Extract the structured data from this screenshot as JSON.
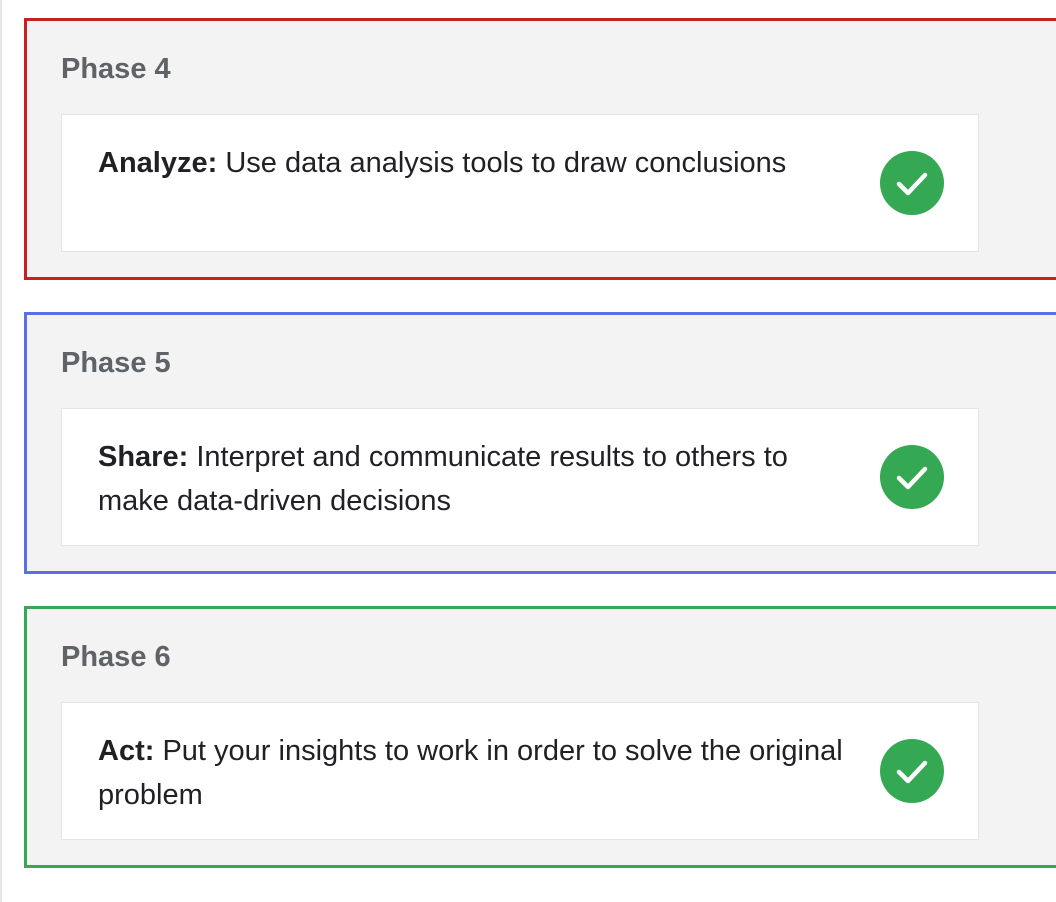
{
  "colors": {
    "phase4_border": "#c5221f",
    "phase5_border": "#5b6fe6",
    "phase6_border": "#34a853",
    "panel_bg": "#f3f3f3",
    "check_green": "#34a853"
  },
  "phases": [
    {
      "title": "Phase 4",
      "term": "Analyze:",
      "description": " Use data analysis tools to draw conclusions",
      "status_icon": "checkmark-circle-icon"
    },
    {
      "title": "Phase 5",
      "term": "Share:",
      "description": " Interpret and communicate results to others to make data-driven decisions",
      "status_icon": "checkmark-circle-icon"
    },
    {
      "title": "Phase 6",
      "term": "Act:",
      "description": " Put your insights to work in order to solve the original problem",
      "status_icon": "checkmark-circle-icon"
    }
  ]
}
